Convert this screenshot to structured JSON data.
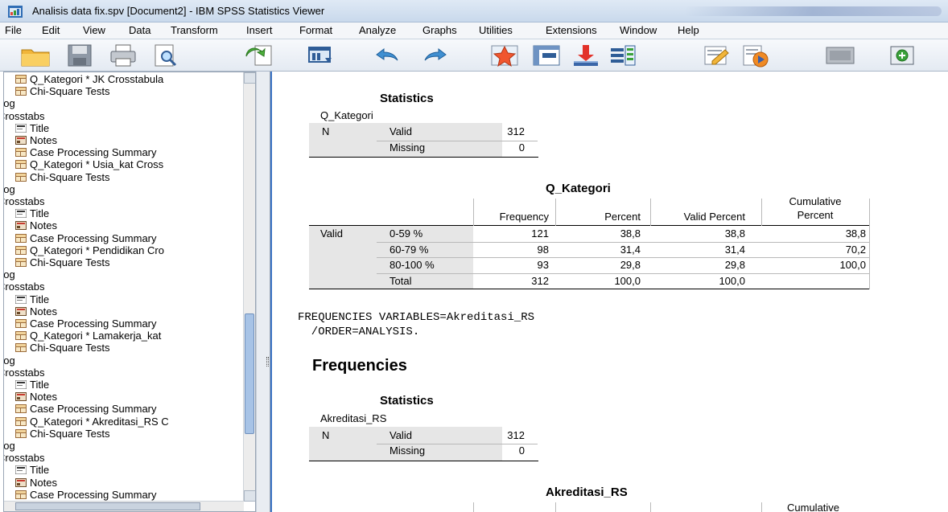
{
  "window": {
    "title": "Analisis data fix.spv [Document2] - IBM SPSS Statistics Viewer"
  },
  "menu": {
    "items": [
      "File",
      "Edit",
      "View",
      "Data",
      "Transform",
      "Insert",
      "Format",
      "Analyze",
      "Graphs",
      "Utilities",
      "Extensions",
      "Window",
      "Help"
    ]
  },
  "toolbar": {
    "icons": [
      "open-folder-icon",
      "save-icon",
      "print-icon",
      "print-preview-icon",
      "export-icon",
      "recall-dialog-icon",
      "undo-icon",
      "redo-icon",
      "goto-data-icon",
      "goto-case-icon",
      "goto-variable-icon",
      "variables-icon",
      "designate-window-icon",
      "run-script-icon",
      "collapse-icon",
      "add-icon"
    ]
  },
  "navigator": {
    "items": [
      {
        "label": "Q_Kategori * JK Crosstabula",
        "kind": "table"
      },
      {
        "label": "Chi-Square Tests",
        "kind": "table"
      },
      {
        "label": "Log",
        "kind": "log"
      },
      {
        "label": "Crosstabs",
        "kind": "heading"
      },
      {
        "label": "Title",
        "kind": "title"
      },
      {
        "label": "Notes",
        "kind": "notes"
      },
      {
        "label": "Case Processing Summary",
        "kind": "table"
      },
      {
        "label": "Q_Kategori * Usia_kat Cross",
        "kind": "table"
      },
      {
        "label": "Chi-Square Tests",
        "kind": "table"
      },
      {
        "label": "Log",
        "kind": "log"
      },
      {
        "label": "Crosstabs",
        "kind": "heading"
      },
      {
        "label": "Title",
        "kind": "title"
      },
      {
        "label": "Notes",
        "kind": "notes"
      },
      {
        "label": "Case Processing Summary",
        "kind": "table"
      },
      {
        "label": "Q_Kategori * Pendidikan Cro",
        "kind": "table"
      },
      {
        "label": "Chi-Square Tests",
        "kind": "table"
      },
      {
        "label": "Log",
        "kind": "log"
      },
      {
        "label": "Crosstabs",
        "kind": "heading"
      },
      {
        "label": "Title",
        "kind": "title"
      },
      {
        "label": "Notes",
        "kind": "notes"
      },
      {
        "label": "Case Processing Summary",
        "kind": "table"
      },
      {
        "label": "Q_Kategori * Lamakerja_kat",
        "kind": "table"
      },
      {
        "label": "Chi-Square Tests",
        "kind": "table"
      },
      {
        "label": "Log",
        "kind": "log"
      },
      {
        "label": "Crosstabs",
        "kind": "heading"
      },
      {
        "label": "Title",
        "kind": "title"
      },
      {
        "label": "Notes",
        "kind": "notes"
      },
      {
        "label": "Case Processing Summary",
        "kind": "table"
      },
      {
        "label": "Q_Kategori * Akreditasi_RS C",
        "kind": "table"
      },
      {
        "label": "Chi-Square Tests",
        "kind": "table"
      },
      {
        "label": "Log",
        "kind": "log"
      },
      {
        "label": "Crosstabs",
        "kind": "heading"
      },
      {
        "label": "Title",
        "kind": "title"
      },
      {
        "label": "Notes",
        "kind": "notes"
      },
      {
        "label": "Case Processing Summary",
        "kind": "table"
      }
    ]
  },
  "output": {
    "stats1": {
      "title": "Statistics",
      "variable": "Q_Kategori",
      "n_label": "N",
      "valid_label": "Valid",
      "valid_value": "312",
      "missing_label": "Missing",
      "missing_value": "0"
    },
    "freq1": {
      "title": "Q_Kategori",
      "headers": {
        "frequency": "Frequency",
        "percent": "Percent",
        "valid_percent": "Valid Percent",
        "cumulative_1": "Cumulative",
        "cumulative_2": "Percent"
      },
      "valid_label": "Valid",
      "rows": [
        {
          "label": "0-59 %",
          "frequency": "121",
          "percent": "38,8",
          "valid_percent": "38,8",
          "cumulative": "38,8"
        },
        {
          "label": "60-79 %",
          "frequency": "98",
          "percent": "31,4",
          "valid_percent": "31,4",
          "cumulative": "70,2"
        },
        {
          "label": "80-100 %",
          "frequency": "93",
          "percent": "29,8",
          "valid_percent": "29,8",
          "cumulative": "100,0"
        },
        {
          "label": "Total",
          "frequency": "312",
          "percent": "100,0",
          "valid_percent": "100,0",
          "cumulative": ""
        }
      ]
    },
    "syntax": {
      "line1": "FREQUENCIES VARIABLES=Akreditasi_RS",
      "line2": "  /ORDER=ANALYSIS."
    },
    "heading": "Frequencies",
    "stats2": {
      "title": "Statistics",
      "variable": "Akreditasi_RS",
      "n_label": "N",
      "valid_label": "Valid",
      "valid_value": "312",
      "missing_label": "Missing",
      "missing_value": "0"
    },
    "freq2": {
      "title": "Akreditasi_RS",
      "cumulative_partial": "Cumulative"
    }
  }
}
